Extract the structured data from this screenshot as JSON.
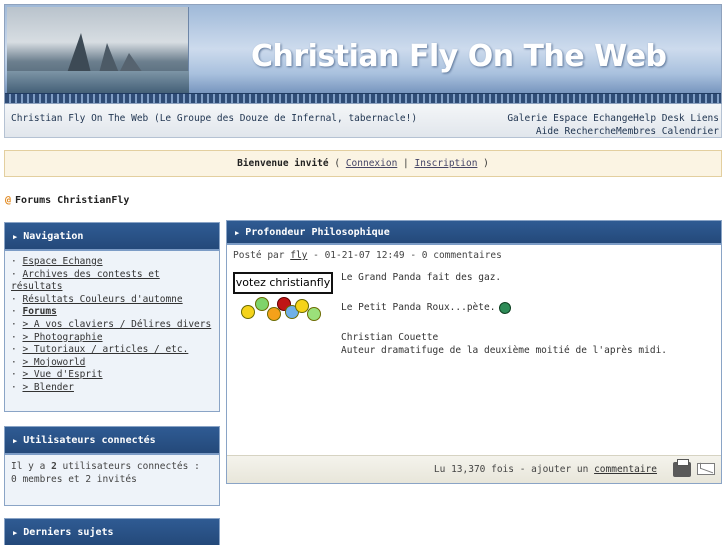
{
  "banner": {
    "title": "Christian Fly On The Web"
  },
  "header": {
    "tagline": "Christian Fly On The Web (Le Groupe des Douze de Infernal, tabernacle!)",
    "nav_row1": [
      "Galerie",
      "Espace Echange",
      "Help Desk",
      "Liens"
    ],
    "nav_row2": [
      "Aide",
      "Recherche",
      "Membres",
      "Calendrier"
    ]
  },
  "welcome": {
    "prefix": "Bienvenue invité",
    "open": "(",
    "login": "Connexion",
    "sep": "|",
    "register": "Inscription",
    "close": ")"
  },
  "forum": {
    "icon": "at-icon",
    "title": "Forums ChristianFly"
  },
  "navigation": {
    "title": "Navigation",
    "items": [
      {
        "bullet": "·",
        "label": "Espace Echange"
      },
      {
        "bullet": "·",
        "label": "Archives des contests et résultats"
      },
      {
        "bullet": "·",
        "label": "Résultats Couleurs d'automne"
      },
      {
        "bullet": "·",
        "label": "Forums"
      },
      {
        "bullet": "·",
        "label": "> A vos claviers / Délires divers"
      },
      {
        "bullet": "·",
        "label": "> Photographie"
      },
      {
        "bullet": "·",
        "label": "> Tutoriaux / articles / etc."
      },
      {
        "bullet": "·",
        "label": "> Mojoworld"
      },
      {
        "bullet": "·",
        "label": "> Vue d'Esprit"
      },
      {
        "bullet": "·",
        "label": "> Blender"
      }
    ]
  },
  "users": {
    "title": "Utilisateurs connectés",
    "line_prefix": "Il y a",
    "count": "2",
    "line_suffix": "utilisateurs connectés :",
    "detail": "0 membres et 2 invités"
  },
  "recent": {
    "title": "Derniers sujets"
  },
  "post": {
    "title": "Profondeur Philosophique",
    "meta_prefix": "Posté par",
    "author": "fly",
    "meta_suffix": "- 01-21-07 12:49 - 0 commentaires",
    "vote_label": "votez christianfly",
    "line1": "Le Grand Panda fait des gaz.",
    "line2": "Le Petit Panda Roux...pète.",
    "sig_name": "Christian Couette",
    "sig_desc": "Auteur dramatifuge de la deuxième moitié de l'après midi.",
    "views_prefix": "Lu 13,370 fois - ajouter un",
    "comment_link": "commentaire"
  },
  "colors": {
    "panel_header": "#2f5b93",
    "panel_bg": "#eef3f9",
    "welcome_bg": "#fbf4e3",
    "accent": "#e0861b"
  }
}
